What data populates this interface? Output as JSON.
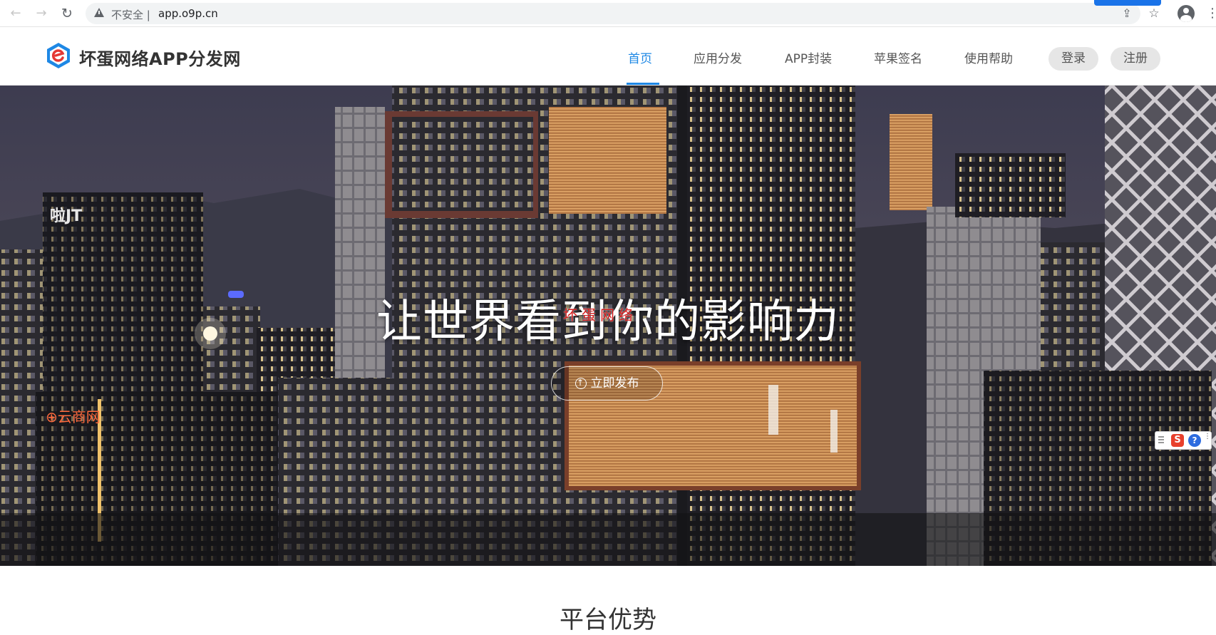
{
  "browser": {
    "insecure_label": "不安全 |",
    "url": "app.o9p.cn",
    "back_icon": "←",
    "forward_icon": "→",
    "reload_icon": "↻",
    "share_icon": "⇪",
    "star_icon": "☆",
    "menu_icon": "⋮"
  },
  "header": {
    "logo_text": "坏蛋网络APP分发网",
    "nav": [
      {
        "label": "首页",
        "active": true
      },
      {
        "label": "应用分发",
        "active": false
      },
      {
        "label": "APP封装",
        "active": false
      },
      {
        "label": "苹果签名",
        "active": false
      },
      {
        "label": "使用帮助",
        "active": false
      }
    ],
    "login_label": "登录",
    "register_label": "注册",
    "accent_color": "#1e88e5"
  },
  "hero": {
    "title": "让世界看到你的影响力",
    "watermark": "坏蛋网络",
    "publish_label": "立即发布"
  },
  "ime": {
    "sogou_label": "S",
    "help_label": "?",
    "more_label": "⋮"
  },
  "section": {
    "title": "平台优势"
  }
}
